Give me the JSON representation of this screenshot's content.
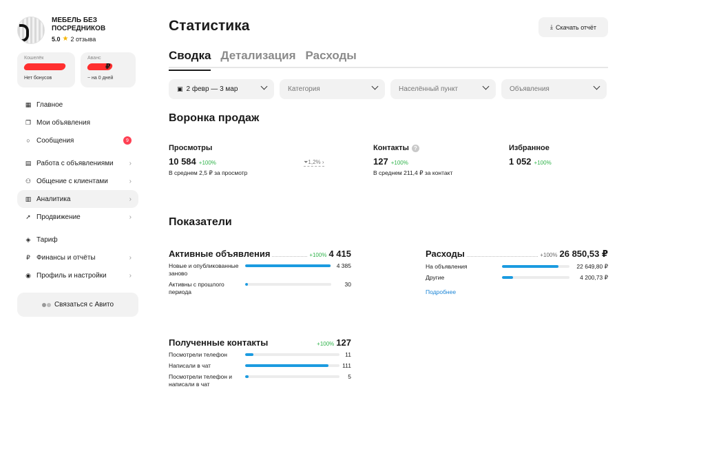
{
  "profile": {
    "name": "МЕБЕЛЬ БЕЗ ПОСРЕДНИКОВ",
    "rating": "5.0",
    "reviews": "2 отзыва"
  },
  "wallets": [
    {
      "label": "Кошелёк",
      "value": "",
      "sub": "Нет бонусов"
    },
    {
      "label": "Аванс",
      "value": "₽",
      "sub": "~ на 0 дней"
    }
  ],
  "nav": [
    {
      "label": "Главное",
      "icon": "grid-icon"
    },
    {
      "label": "Мои объявления",
      "icon": "copy-icon"
    },
    {
      "label": "Сообщения",
      "icon": "chat-icon",
      "badge": "9"
    },
    {
      "label": "Работа с объявлениями",
      "icon": "list-icon"
    },
    {
      "label": "Общение с клиентами",
      "icon": "people-icon"
    },
    {
      "label": "Аналитика",
      "icon": "chart-icon"
    },
    {
      "label": "Продвижение",
      "icon": "rocket-icon"
    },
    {
      "label": "Тариф",
      "icon": "diamond-icon"
    },
    {
      "label": "Финансы и отчёты",
      "icon": "ruble-icon"
    },
    {
      "label": "Профиль и настройки",
      "icon": "user-icon"
    }
  ],
  "contact_btn": "Связаться с Авито",
  "page_title": "Статистика",
  "download_btn": "Скачать отчёт",
  "tabs": [
    "Сводка",
    "Детализация",
    "Расходы"
  ],
  "filters": {
    "date": "2 февр — 3 мар",
    "category": "Категория",
    "city": "Населённый пункт",
    "ads": "Объявления"
  },
  "funnel": {
    "title": "Воронка продаж",
    "views": {
      "label": "Просмотры",
      "value": "10 584",
      "change": "+100%",
      "avg": "В среднем 2,5 ₽ за просмотр"
    },
    "conversion": "1,2%",
    "contacts": {
      "label": "Контакты",
      "value": "127",
      "change": "+100%",
      "avg": "В среднем 211,4 ₽ за контакт"
    },
    "favorites": {
      "label": "Избранное",
      "value": "1 052",
      "change": "+100%"
    }
  },
  "indicators": {
    "title": "Показатели",
    "active": {
      "title": "Активные объявления",
      "change": "+100%",
      "value": "4 415",
      "rows": [
        {
          "label": "Новые и опубликованные заново",
          "value": "4 385",
          "fraction": 0.993
        },
        {
          "label": "Активны с прошлого периода",
          "value": "30",
          "fraction": 0.03
        }
      ]
    },
    "expenses": {
      "title": "Расходы",
      "change": "+100%",
      "value": "26 850,53 ₽",
      "rows": [
        {
          "label": "На объявления",
          "value": "22 649,80 ₽",
          "fraction": 0.84
        },
        {
          "label": "Другие",
          "value": "4 200,73 ₽",
          "fraction": 0.16
        }
      ],
      "more": "Подробнее"
    },
    "contacts": {
      "title": "Полученные контакты",
      "change": "+100%",
      "value": "127",
      "rows": [
        {
          "label": "Посмотрели телефон",
          "value": "11",
          "fraction": 0.09
        },
        {
          "label": "Написали в чат",
          "value": "111",
          "fraction": 0.88
        },
        {
          "label": "Посмотрели телефон и написали в чат",
          "value": "5",
          "fraction": 0.04
        }
      ]
    }
  },
  "colors": {
    "accent": "#1b9be0",
    "green": "#2fb34a",
    "badge": "#ff4053"
  }
}
